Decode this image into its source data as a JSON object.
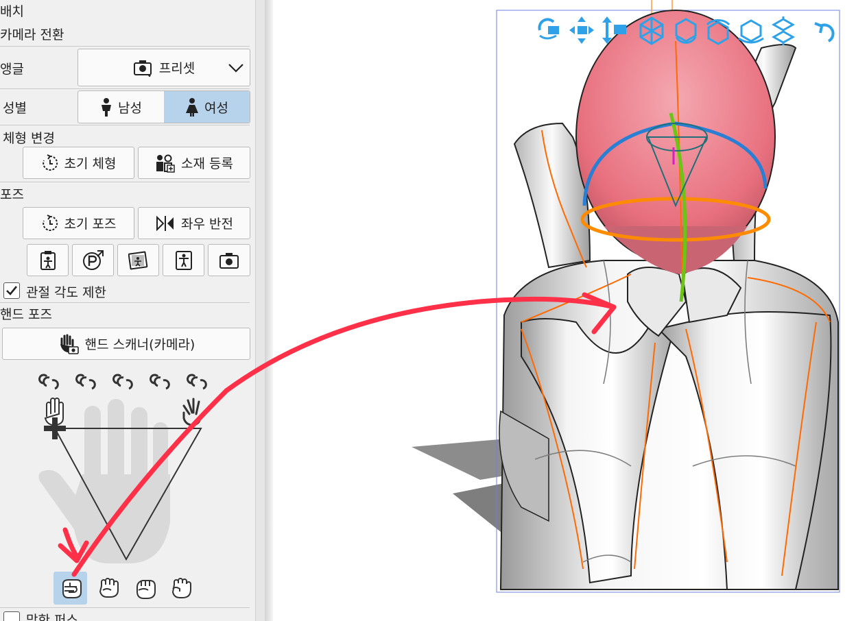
{
  "panel": {
    "sections": {
      "placement": "배치",
      "camera_switch": "카메라 전환",
      "body_change": "체형 변경",
      "pose": "포즈",
      "hand_pose": "핸드 포즈",
      "bottom_partial": "망한 퍼스"
    },
    "angle": {
      "label": "앵글",
      "value": "프리셋"
    },
    "gender": {
      "label": "성별",
      "options": [
        "남성",
        "여성"
      ],
      "selected": "여성"
    },
    "body_buttons": {
      "initial_body": "초기 체형",
      "register_material": "소재 등록"
    },
    "pose_buttons": {
      "initial_pose": "초기 포즈",
      "flip": "좌우 반전"
    },
    "joint_limit": {
      "label": "관절 각도 제한",
      "checked": true
    },
    "hand_scanner": {
      "label": "핸드 스캐너(카메라)"
    }
  },
  "colors": {
    "selected_bg": "#b7d3ec",
    "toolbar_blue": "#2ea1e8",
    "arrow_red": "#ff3048",
    "head_pink": "#e8707e",
    "ring_blue": "#2a7fd4",
    "ring_orange": "#ff8c00",
    "spine_green": "#6cc417"
  }
}
